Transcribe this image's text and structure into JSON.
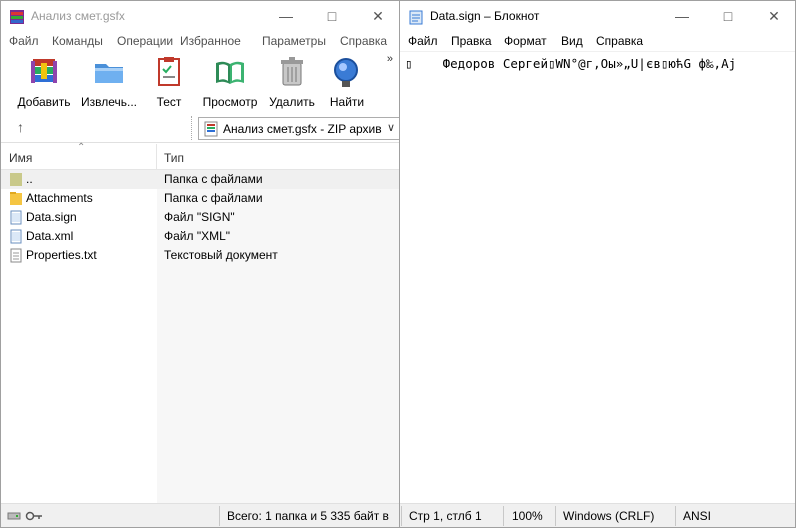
{
  "winrar": {
    "title": "Анализ смет.gsfx",
    "menu": [
      "Файл",
      "Команды",
      "Операции",
      "Избранное",
      "Параметры",
      "Справка"
    ],
    "toolbar": [
      {
        "label": "Добавить",
        "icon": "winrar-books-icon"
      },
      {
        "label": "Извлечь...",
        "icon": "extract-folder-icon"
      },
      {
        "label": "Тест",
        "icon": "test-checklist-icon"
      },
      {
        "label": "Просмотр",
        "icon": "view-book-icon"
      },
      {
        "label": "Удалить",
        "icon": "trash-can-icon"
      },
      {
        "label": "Найти",
        "icon": "magnifier-icon"
      }
    ],
    "address": "Анализ смет.gsfx - ZIP архив",
    "columns": {
      "name": "Имя",
      "type": "Тип"
    },
    "files": [
      {
        "name": "..",
        "type": "Папка с файлами",
        "icon": "parent-folder-icon"
      },
      {
        "name": "Attachments",
        "type": "Папка с файлами",
        "icon": "folder-icon"
      },
      {
        "name": "Data.sign",
        "type": "Файл \"SIGN\"",
        "icon": "file-icon"
      },
      {
        "name": "Data.xml",
        "type": "Файл \"XML\"",
        "icon": "file-icon"
      },
      {
        "name": "Properties.txt",
        "type": "Текстовый документ",
        "icon": "text-file-icon"
      }
    ],
    "status": "Всего: 1 папка и 5 335 байт в"
  },
  "notepad": {
    "title": "Data.sign – Блокнот",
    "menu": [
      "Файл",
      "Правка",
      "Формат",
      "Вид",
      "Справка"
    ],
    "content": "▯    Федоров Сергей▯WN°@г,Оы»„U|єв▯юћG ф‰,Aj",
    "status": {
      "position": "Стр 1, стлб 1",
      "zoom": "100%",
      "line_endings": "Windows (CRLF)",
      "encoding": "ANSI"
    }
  },
  "colors": {
    "selected_row": "#f0f0f0",
    "folder": "#f5c542",
    "text_gray": "#9a9a9a"
  }
}
